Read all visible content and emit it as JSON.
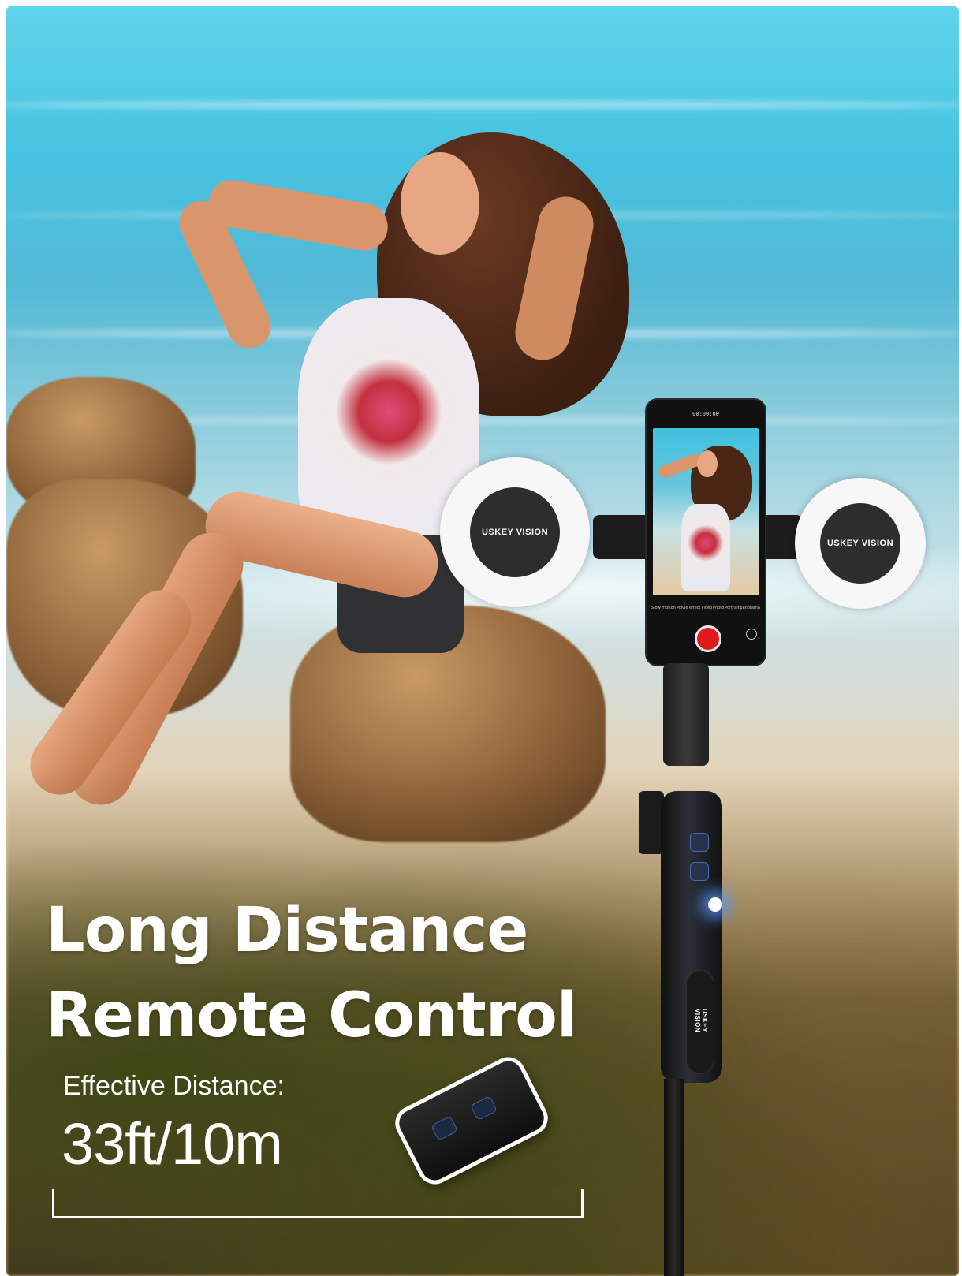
{
  "headline": {
    "line1": "Long Distance",
    "line2": "Remote Control"
  },
  "effective_distance": {
    "label": "Effective Distance:",
    "value": "33ft/10m"
  },
  "brand_marks": [
    "USKEY VISION",
    "USKEY VISION",
    "USKEY VISION"
  ],
  "phone": {
    "timer": "00:00:00",
    "modes": [
      "Slow motion",
      "Movie effect",
      "Video",
      "Photo",
      "Portrait",
      "panorama"
    ],
    "active_mode": "Video"
  },
  "colors": {
    "headline": "#ffffff",
    "shutter": "#e2191f",
    "remote_led": "#5a96ff"
  }
}
